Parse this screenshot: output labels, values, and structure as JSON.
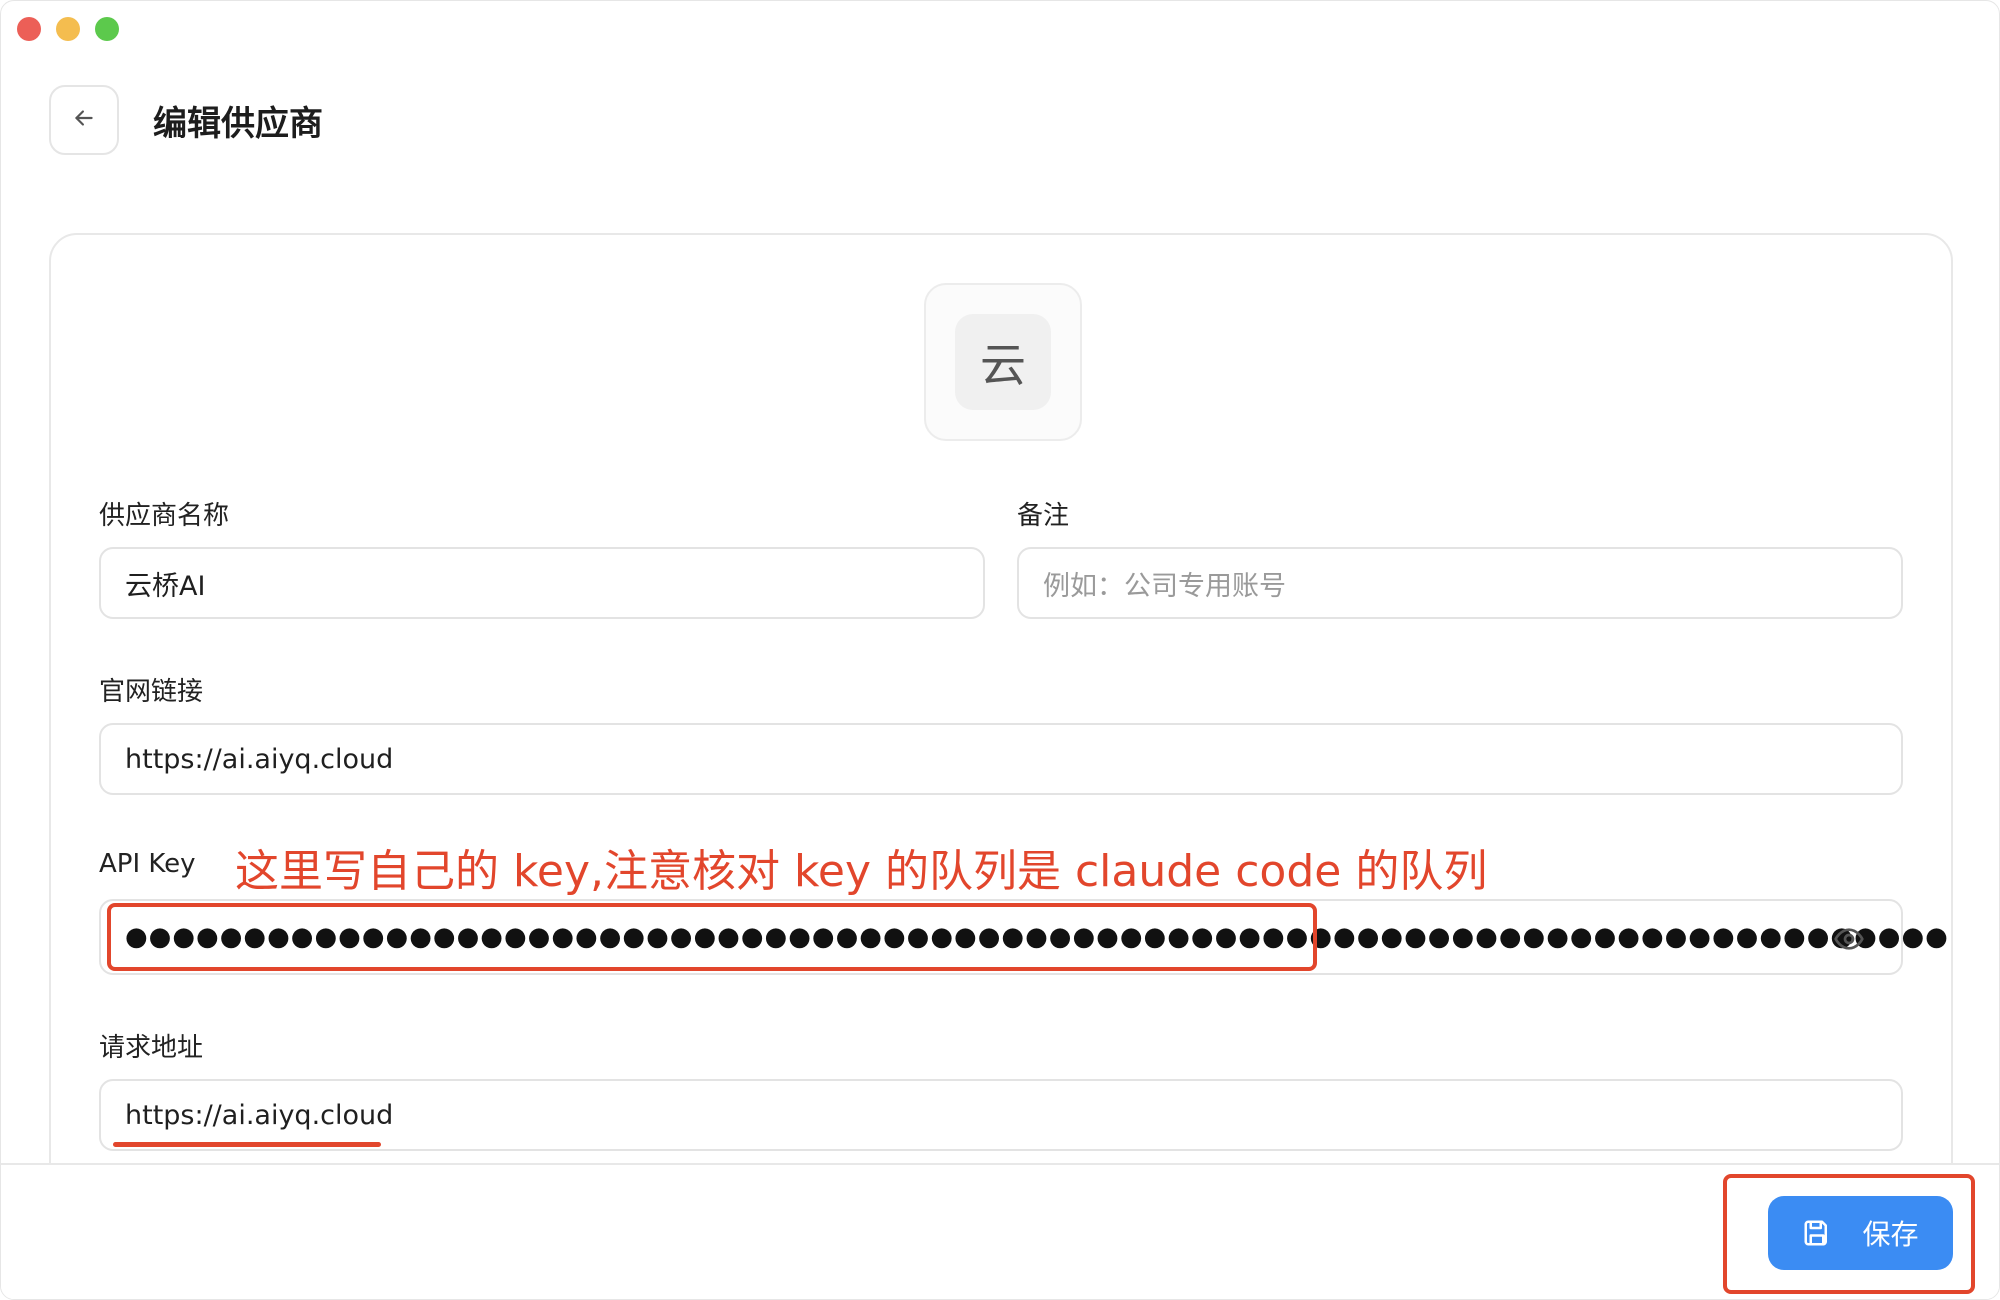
{
  "window": {
    "controls": [
      "close",
      "minimize",
      "zoom"
    ]
  },
  "header": {
    "title": "编辑供应商",
    "back_icon": "arrow-left-icon"
  },
  "avatar": {
    "glyph": "云"
  },
  "form": {
    "name": {
      "label": "供应商名称",
      "value": "云桥AI"
    },
    "note": {
      "label": "备注",
      "placeholder": "例如：公司专用账号"
    },
    "website": {
      "label": "官网链接",
      "value": "https://ai.aiyq.cloud"
    },
    "api_key": {
      "label": "API Key",
      "masked_value": "●●●●●●●●●●●●●●●●●●●●●●●●●●●●●●●●●●●●●●●●●●●●●●●●●●●●●●●●●●●●●●●●●●●●●●●●●●●●●",
      "toggle_icon": "eye-icon"
    },
    "endpoint": {
      "label": "请求地址",
      "value": "https://ai.aiyq.cloud"
    }
  },
  "annotation": {
    "text": "这里写自己的 key,注意核对 key 的队列是 claude code 的队列",
    "color": "#e2462c"
  },
  "footer": {
    "save_label": "保存",
    "save_icon": "save-icon",
    "accent": "#3b8cf3"
  }
}
